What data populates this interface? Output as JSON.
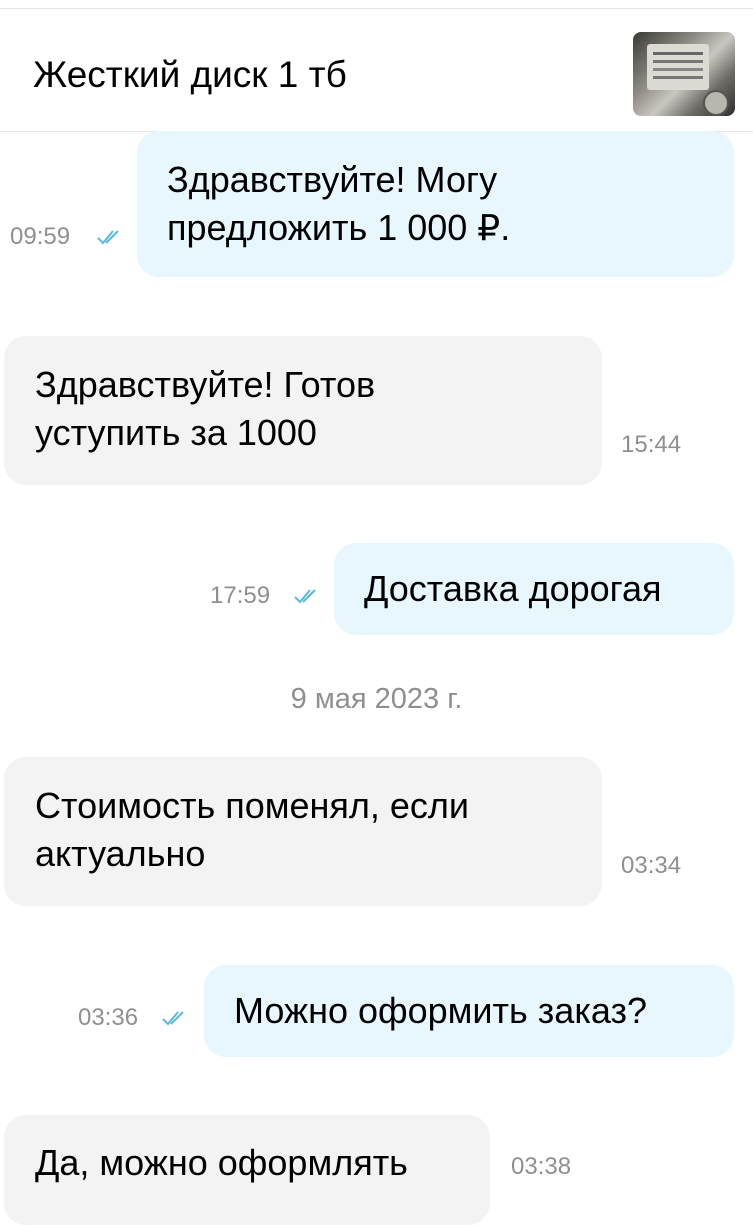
{
  "header": {
    "title": "Жесткий диск 1 тб",
    "thumbnail_icon": "hard-drive-photo"
  },
  "messages": [
    {
      "direction": "outgoing",
      "text": "Здравствуйте! Могу предложить 1 000 ₽.",
      "time": "09:59",
      "status": "read"
    },
    {
      "direction": "incoming",
      "text": "Здравствуйте! Готов уступить за 1000",
      "time": "15:44"
    },
    {
      "direction": "outgoing",
      "text": "Доставка дорогая",
      "time": "17:59",
      "status": "read"
    },
    {
      "direction": "incoming",
      "text": "Стоимость поменял, если актуально",
      "time": "03:34"
    },
    {
      "direction": "outgoing",
      "text": "Можно оформить заказ?",
      "time": "03:36",
      "status": "read"
    },
    {
      "direction": "incoming",
      "text": "Да, можно оформлять",
      "time": "03:38"
    }
  ],
  "date_separator": "9 мая 2023 г.",
  "colors": {
    "outgoing_bubble": "#e8f6fe",
    "incoming_bubble": "#f3f3f3",
    "read_check": "#5ab8e6",
    "time_text": "#8f8f8f"
  }
}
